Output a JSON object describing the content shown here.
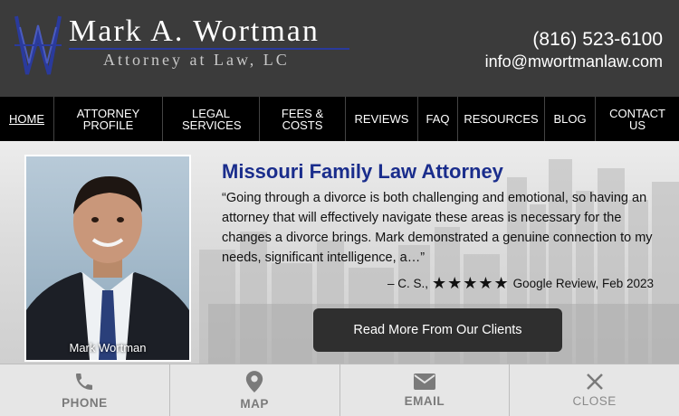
{
  "header": {
    "firm_name": "Mark A. Wortman",
    "firm_subtitle": "Attorney at Law, LC",
    "phone": "(816) 523-6100",
    "email": "info@mwortmanlaw.com"
  },
  "nav": {
    "items": [
      {
        "label": "HOME",
        "active": true
      },
      {
        "label": "ATTORNEY PROFILE"
      },
      {
        "label": "LEGAL SERVICES"
      },
      {
        "label": "FEES & COSTS"
      },
      {
        "label": "REVIEWS"
      },
      {
        "label": "FAQ"
      },
      {
        "label": "RESOURCES"
      },
      {
        "label": "BLOG"
      },
      {
        "label": "CONTACT US"
      }
    ]
  },
  "hero": {
    "title": "Missouri Family Law Attorney",
    "quote": "“Going through a divorce is both challenging and emotional, so having an attorney that will effectively navigate these areas is necessary for the changes a divorce brings. Mark demonstrated a genuine connection to my needs, significant intelligence, a…”",
    "review_author": "– C. S.,",
    "rating_stars": "★★★★★",
    "review_source": "Google Review, Feb 2023",
    "portrait_caption": "Mark Wortman",
    "read_more_label": "Read More From Our Clients"
  },
  "bottom_bar": {
    "phone_label": "PHONE",
    "map_label": "MAP",
    "email_label": "EMAIL",
    "close_label": "CLOSE"
  },
  "colors": {
    "header_bg": "#3b3b3b",
    "nav_bg": "#000000",
    "title_blue": "#1a2d8c",
    "button_dark": "#2f2f2f"
  }
}
